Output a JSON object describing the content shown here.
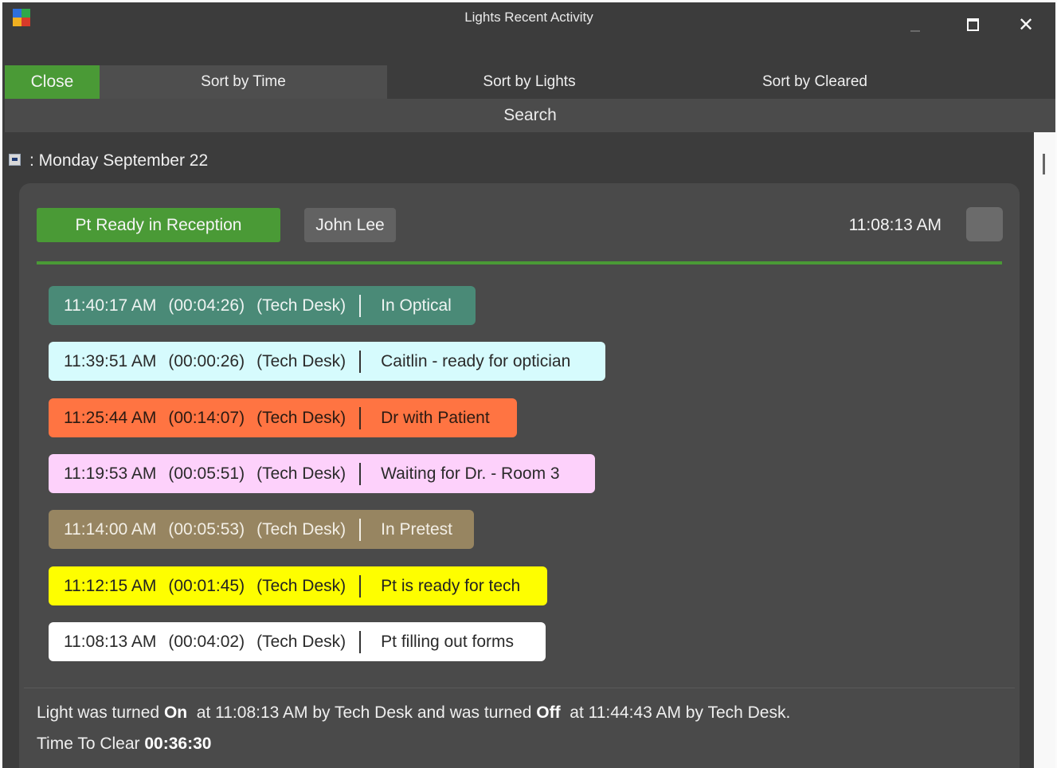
{
  "window": {
    "title": "Lights Recent Activity",
    "logo_colors": [
      "#2e6fdc",
      "#2fa84a",
      "#f0b020",
      "#d83a2a"
    ]
  },
  "toolbar": {
    "close_label": "Close",
    "sort_time_label": "Sort by Time",
    "sort_lights_label": "Sort by Lights",
    "sort_cleared_label": "Sort by Cleared",
    "search_label": "Search"
  },
  "group": {
    "date_label": ": Monday September 22",
    "collapse_icon": "collapse-minus-icon"
  },
  "card": {
    "light_name": "Pt Ready in Reception",
    "light_color": "#4a9a36",
    "person": "John Lee",
    "time": "11:08:13 AM"
  },
  "entries": [
    {
      "time": "11:40:17 AM",
      "duration": "(00:04:26)",
      "source": "(Tech Desk)",
      "label": "In Optical",
      "bg": "#4a8a77",
      "fg": "#eef4f2",
      "sep": "#e8f0ee"
    },
    {
      "time": "11:39:51 AM",
      "duration": "(00:00:26)",
      "source": "(Tech Desk)",
      "label": "Caitlin - ready for optician",
      "bg": "#d6fbfd",
      "fg": "#2a2a2a",
      "sep": "#333333"
    },
    {
      "time": "11:25:44 AM",
      "duration": "(00:14:07)",
      "source": "(Tech Desk)",
      "label": "Dr with Patient",
      "bg": "#ff7442",
      "fg": "#2a1a12",
      "sep": "#3a2a22"
    },
    {
      "time": "11:19:53 AM",
      "duration": "(00:05:51)",
      "source": "(Tech Desk)",
      "label": "Waiting for Dr. - Room 3",
      "bg": "#fdd1fb",
      "fg": "#2a2a2a",
      "sep": "#333333"
    },
    {
      "time": "11:14:00 AM",
      "duration": "(00:05:53)",
      "source": "(Tech Desk)",
      "label": "In Pretest",
      "bg": "#978561",
      "fg": "#f3efe6",
      "sep": "#f3efe6"
    },
    {
      "time": "11:12:15 AM",
      "duration": "(00:01:45)",
      "source": "(Tech Desk)",
      "label": "Pt is ready for tech",
      "bg": "#fefe00",
      "fg": "#222222",
      "sep": "#333333"
    },
    {
      "time": "11:08:13 AM",
      "duration": "(00:04:02)",
      "source": "(Tech Desk)",
      "label": "Pt filling out forms",
      "bg": "#ffffff",
      "fg": "#2a2a2a",
      "sep": "#333333"
    }
  ],
  "summary": {
    "on_prefix": "Light was turned ",
    "on_word": "On",
    "on_middle": "  at 11:08:13 AM by Tech Desk and was turned ",
    "off_word": "Off",
    "off_suffix": "  at 11:44:43 AM by Tech Desk.",
    "clear_label": "Time To Clear ",
    "clear_value": "00:36:30"
  }
}
